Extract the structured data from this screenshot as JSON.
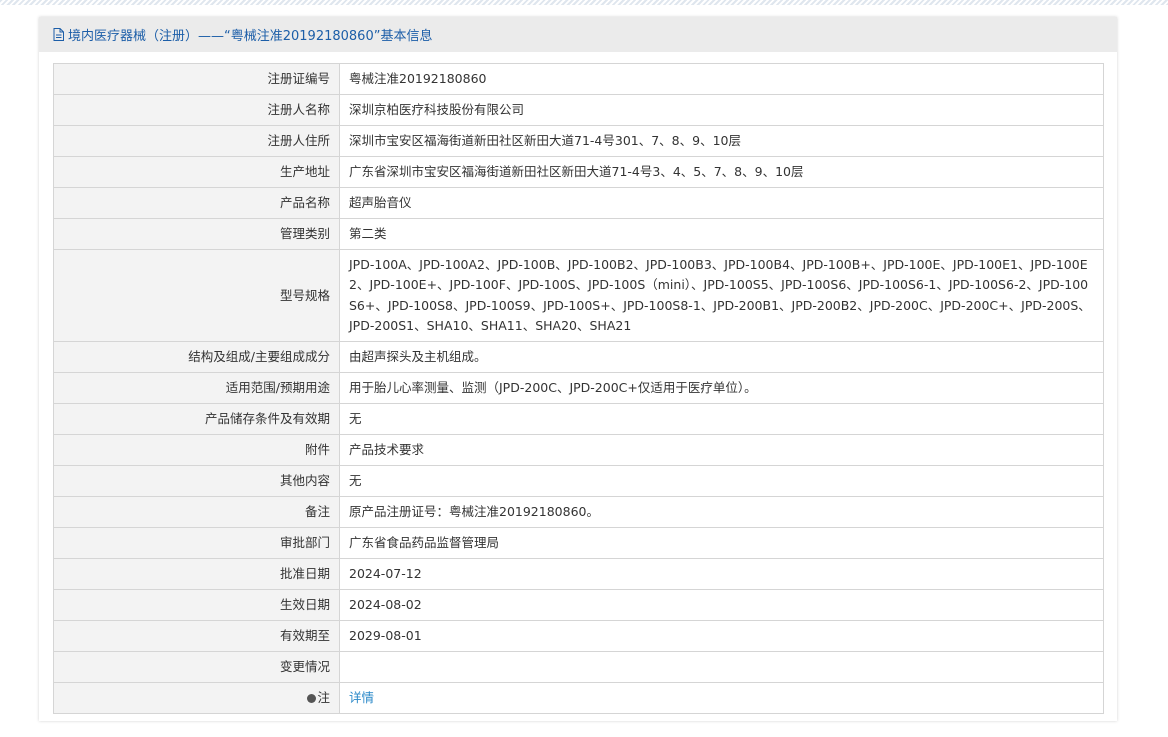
{
  "header": {
    "title": "境内医疗器械（注册）——“粤械注准20192180860”基本信息"
  },
  "rows": [
    {
      "key": "注册证编号",
      "value": "粤械注准20192180860"
    },
    {
      "key": "注册人名称",
      "value": "深圳京柏医疗科技股份有限公司"
    },
    {
      "key": "注册人住所",
      "value": "深圳市宝安区福海街道新田社区新田大道71-4号301、7、8、9、10层"
    },
    {
      "key": "生产地址",
      "value": "广东省深圳市宝安区福海街道新田社区新田大道71-4号3、4、5、7、8、9、10层"
    },
    {
      "key": "产品名称",
      "value": "超声胎音仪"
    },
    {
      "key": "管理类别",
      "value": "第二类"
    },
    {
      "key": "型号规格",
      "value": "JPD-100A、JPD-100A2、JPD-100B、JPD-100B2、JPD-100B3、JPD-100B4、JPD-100B+、JPD-100E、JPD-100E1、JPD-100E2、JPD-100E+、JPD-100F、JPD-100S、JPD-100S（mini）、JPD-100S5、JPD-100S6、JPD-100S6-1、JPD-100S6-2、JPD-100S6+、JPD-100S8、JPD-100S9、JPD-100S+、JPD-100S8-1、JPD-200B1、JPD-200B2、JPD-200C、JPD-200C+、JPD-200S、JPD-200S1、SHA10、SHA11、SHA20、SHA21"
    },
    {
      "key": "结构及组成/主要组成成分",
      "value": "由超声探头及主机组成。"
    },
    {
      "key": "适用范围/预期用途",
      "value": "用于胎儿心率测量、监测（JPD-200C、JPD-200C+仅适用于医疗单位）。"
    },
    {
      "key": "产品储存条件及有效期",
      "value": "无"
    },
    {
      "key": "附件",
      "value": "产品技术要求"
    },
    {
      "key": "其他内容",
      "value": "无"
    },
    {
      "key": "备注",
      "value": "原产品注册证号：粤械注准20192180860。"
    },
    {
      "key": "审批部门",
      "value": "广东省食品药品监督管理局"
    },
    {
      "key": "批准日期",
      "value": "2024-07-12"
    },
    {
      "key": "生效日期",
      "value": "2024-08-02"
    },
    {
      "key": "有效期至",
      "value": "2029-08-01"
    },
    {
      "key": "变更情况",
      "value": ""
    },
    {
      "key": "注",
      "value": "详情"
    }
  ],
  "colors": {
    "header_text": "#1c5ea8",
    "link": "#2a88c8",
    "key_bg": "#f3f3f3",
    "border": "#d5d5d5"
  },
  "icons": {
    "header": "document-icon",
    "note": "pin-icon"
  }
}
